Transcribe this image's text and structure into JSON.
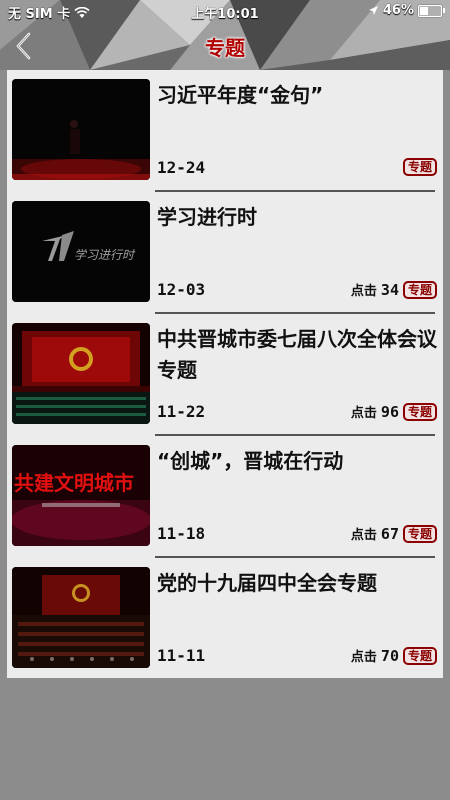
{
  "status_bar": {
    "carrier": "无 SIM 卡",
    "time": "上午10:01",
    "battery": "46%",
    "battery_level": 0.46
  },
  "nav": {
    "title": "专题"
  },
  "items": [
    {
      "title": "习近平年度“金句”",
      "date": "12-24",
      "clicks_label": "",
      "clicks": "",
      "tag": "专题"
    },
    {
      "title": "学习进行时",
      "date": "12-03",
      "clicks_label": "点击",
      "clicks": "34",
      "tag": "专题"
    },
    {
      "title": "中共晋城市委七届八次全体会议专题",
      "date": "11-22",
      "clicks_label": "点击",
      "clicks": "96",
      "tag": "专题"
    },
    {
      "title": "“创城”，晋城在行动",
      "date": "11-18",
      "clicks_label": "点击",
      "clicks": "67",
      "tag": "专题"
    },
    {
      "title": "党的十九届四中全会专题",
      "date": "11-11",
      "clicks_label": "点击",
      "clicks": "70",
      "tag": "专题"
    }
  ],
  "thumb_texts": {
    "item1": "学习进行时",
    "item3": "共建文明城市"
  }
}
